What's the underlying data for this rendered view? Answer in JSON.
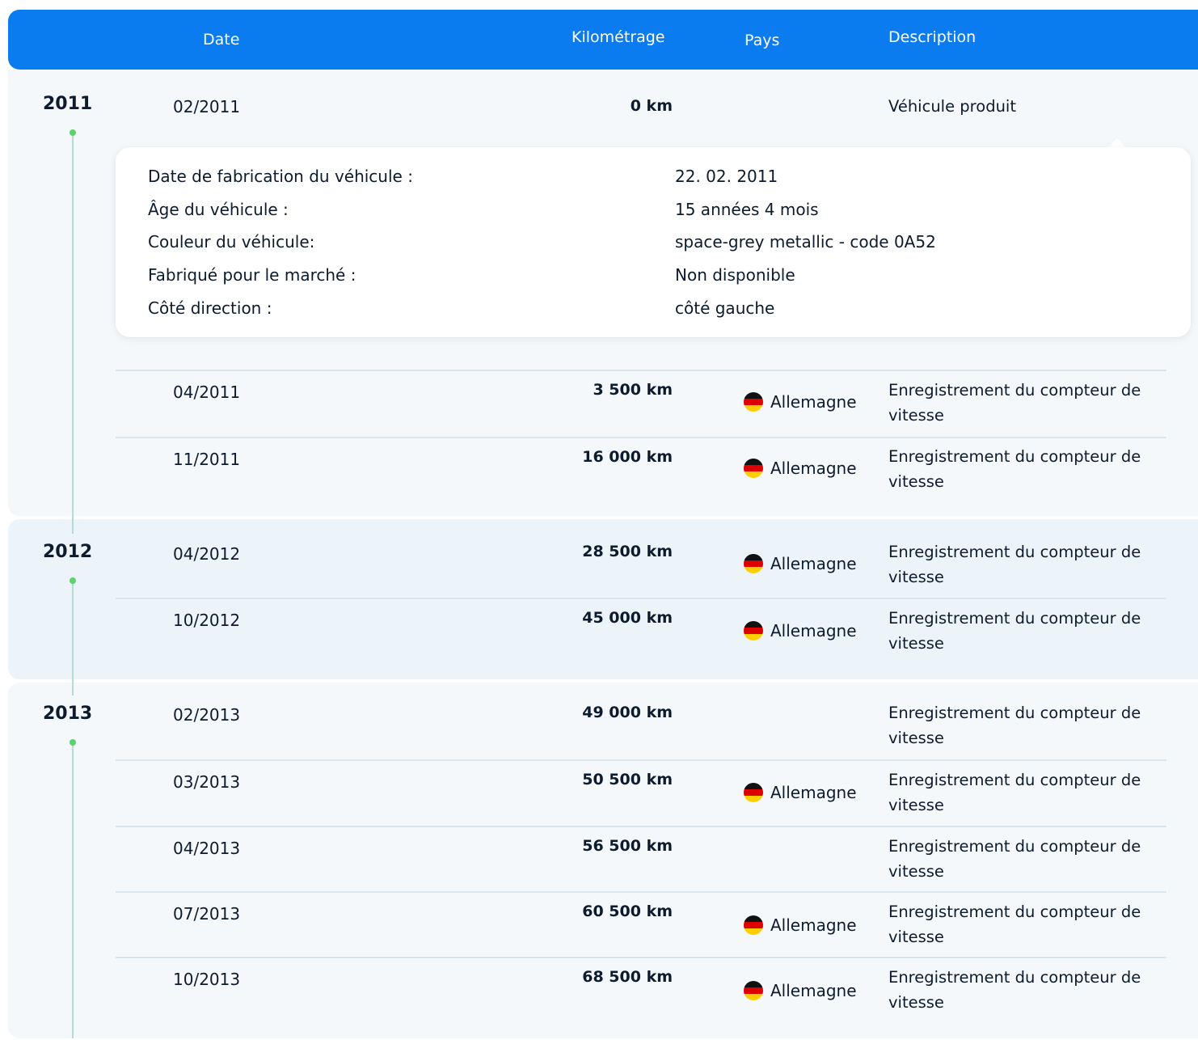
{
  "header": {
    "date": "Date",
    "km": "Kilométrage",
    "pays": "Pays",
    "description": "Description"
  },
  "years": [
    "2011",
    "2012",
    "2013"
  ],
  "details": [
    {
      "label": "Date de fabrication du véhicule :",
      "value": "22. 02. 2011"
    },
    {
      "label": "Âge du véhicule :",
      "value": "15 années 4 mois"
    },
    {
      "label": "Couleur du véhicule:",
      "value": "space-grey metallic - code 0A52"
    },
    {
      "label": "Fabriqué pour le marché :",
      "value": "Non disponible"
    },
    {
      "label": "Côté direction :",
      "value": "côté gauche"
    }
  ],
  "rows": [
    {
      "date": "02/2011",
      "km": "0 km",
      "country": "",
      "description": "Véhicule produit"
    },
    {
      "date": "04/2011",
      "km": "3 500 km",
      "country": "Allemagne",
      "description": "Enregistrement du compteur de vitesse"
    },
    {
      "date": "11/2011",
      "km": "16 000 km",
      "country": "Allemagne",
      "description": "Enregistrement du compteur de vitesse"
    },
    {
      "date": "04/2012",
      "km": "28 500 km",
      "country": "Allemagne",
      "description": "Enregistrement du compteur de vitesse"
    },
    {
      "date": "10/2012",
      "km": "45 000 km",
      "country": "Allemagne",
      "description": "Enregistrement du compteur de vitesse"
    },
    {
      "date": "02/2013",
      "km": "49 000 km",
      "country": "",
      "description": "Enregistrement du compteur de vitesse"
    },
    {
      "date": "03/2013",
      "km": "50 500 km",
      "country": "Allemagne",
      "description": "Enregistrement du compteur de vitesse"
    },
    {
      "date": "04/2013",
      "km": "56 500 km",
      "country": "",
      "description": "Enregistrement du compteur de vitesse"
    },
    {
      "date": "07/2013",
      "km": "60 500 km",
      "country": "Allemagne",
      "description": "Enregistrement du compteur de vitesse"
    },
    {
      "date": "10/2013",
      "km": "68 500 km",
      "country": "Allemagne",
      "description": "Enregistrement du compteur de vitesse"
    }
  ]
}
